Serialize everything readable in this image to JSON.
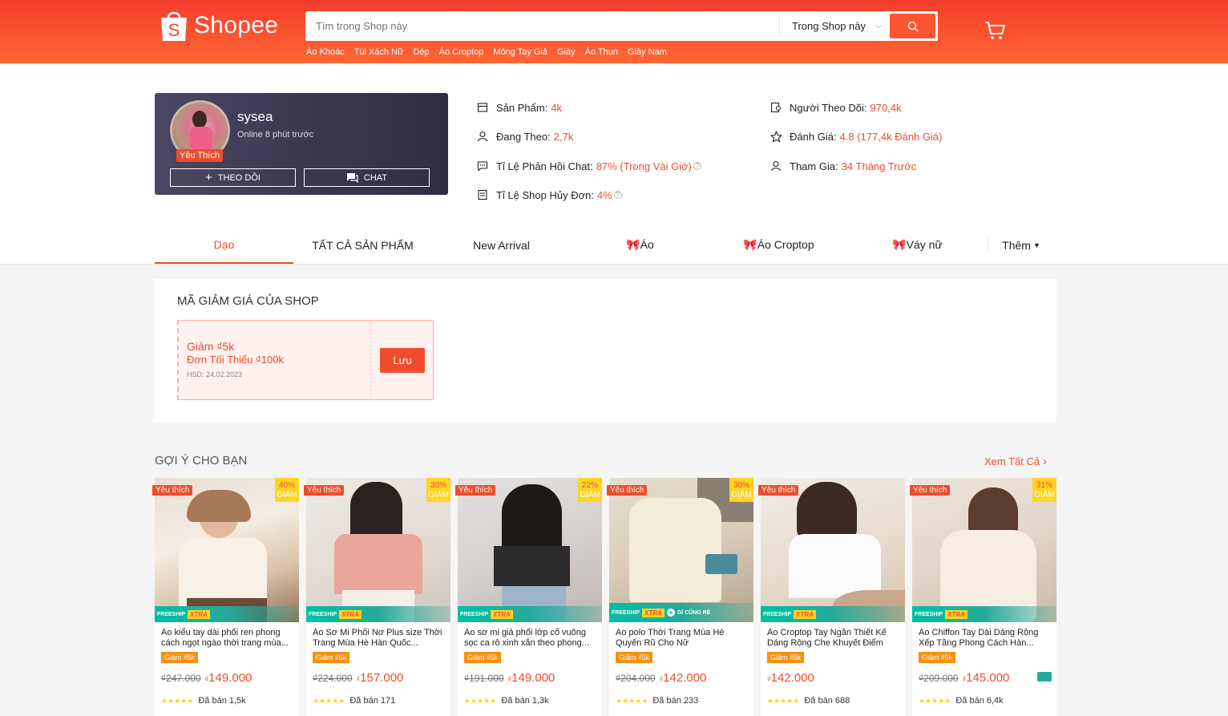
{
  "header": {
    "logo_text": "Shopee",
    "search_placeholder": "Tìm trong Shop này",
    "search_scope": "Trong Shop này",
    "suggestions": [
      "Áo Khoác",
      "Túi Xách Nữ",
      "Dép",
      "Áo Croptop",
      "Móng Tay Giả",
      "Giày",
      "Áo Thun",
      "Giày Nam"
    ]
  },
  "shop": {
    "name": "sysea",
    "online": "Online 8 phút trước",
    "fav_badge": "Yêu Thích",
    "follow_label": "THEO DÕI",
    "chat_label": "CHAT"
  },
  "stats": {
    "products_label": "Sản Phẩm:",
    "products_value": "4k",
    "following_label": "Đang Theo:",
    "following_value": "2,7k",
    "chat_rate_label": "Tỉ Lệ Phản Hồi Chat:",
    "chat_rate_value": "87% (Trong Vài Giờ)",
    "cancel_label": "Tỉ Lệ Shop Hủy Đơn:",
    "cancel_value": "4%",
    "followers_label": "Người Theo Dõi:",
    "followers_value": "970,4k",
    "rating_label": "Đánh Giá:",
    "rating_value": "4.8 (177,4k Đánh Giá)",
    "joined_label": "Tham Gia:",
    "joined_value": "34 Tháng Trước"
  },
  "tabs": [
    "Dạo",
    "TẤT CẢ SẢN PHẨM",
    "New Arrival",
    "🎀Áo",
    "🎀Áo Croptop",
    "🎀Váy nữ",
    "Thêm"
  ],
  "vouchers": {
    "title": "MÃ GIẢM GIÁ CỦA SHOP",
    "amount": "Giảm ₫5k",
    "min_order": "Đơn Tối Thiểu ₫100k",
    "expiry": "HSD: 24.02.2023",
    "save_label": "Lưu"
  },
  "recommend": {
    "title": "GỢI Ý CHO BẠN",
    "see_all": "Xem Tất Cả",
    "fav_label": "Yêu thích",
    "giam_label": "GIẢM",
    "discount_tag": "Giảm ₫5k",
    "freeship": "FREESHIP",
    "xtra": "XTRA",
    "gi_cung_re": "GÌ CŨNG RẺ",
    "stars": "★★★★★",
    "products": [
      {
        "name": "Áo kiểu tay dài phối ren phong cách ngọt ngào thời trang mùa...",
        "old": "₫247.000",
        "cur": "₫",
        "price": "149.000",
        "sold": "Đã bán 1,5k",
        "discount": "40%"
      },
      {
        "name": "Áo Sơ Mi Phối Nơ Plus size Thời Trang Mùa Hè Hàn Quốc...",
        "old": "₫224.000",
        "cur": "₫",
        "price": "157.000",
        "sold": "Đã bán 171",
        "discount": "30%"
      },
      {
        "name": "Áo sơ mi giả phối lớp cổ vuông sọc ca rô xinh xắn theo phong...",
        "old": "₫191.000",
        "cur": "₫",
        "price": "149.000",
        "sold": "Đã bán 1,3k",
        "discount": "22%"
      },
      {
        "name": "Áo polo Thời Trang Mùa Hè Quyến Rũ Cho Nữ",
        "old": "₫204.000",
        "cur": "₫",
        "price": "142.000",
        "sold": "Đã bán 233",
        "discount": "30%"
      },
      {
        "name": "Áo Croptop Tay Ngắn Thiết Kế Dáng Rộng Che Khuyết Điểm",
        "old": "",
        "cur": "₫",
        "price": "142.000",
        "sold": "Đã bán 688",
        "discount": ""
      },
      {
        "name": "Áo Chiffon Tay Dài Dáng Rộng Xếp Tầng Phong Cách Hàn...",
        "old": "₫209.000",
        "cur": "₫",
        "price": "145.000",
        "sold": "Đã bán 6,4k",
        "discount": "31%"
      }
    ]
  },
  "colors": {
    "brand": "#ee4d2d",
    "header_from": "#f53d2d",
    "header_to": "#ff6633",
    "star": "#ffce3d",
    "freeship": "#26aa99"
  }
}
